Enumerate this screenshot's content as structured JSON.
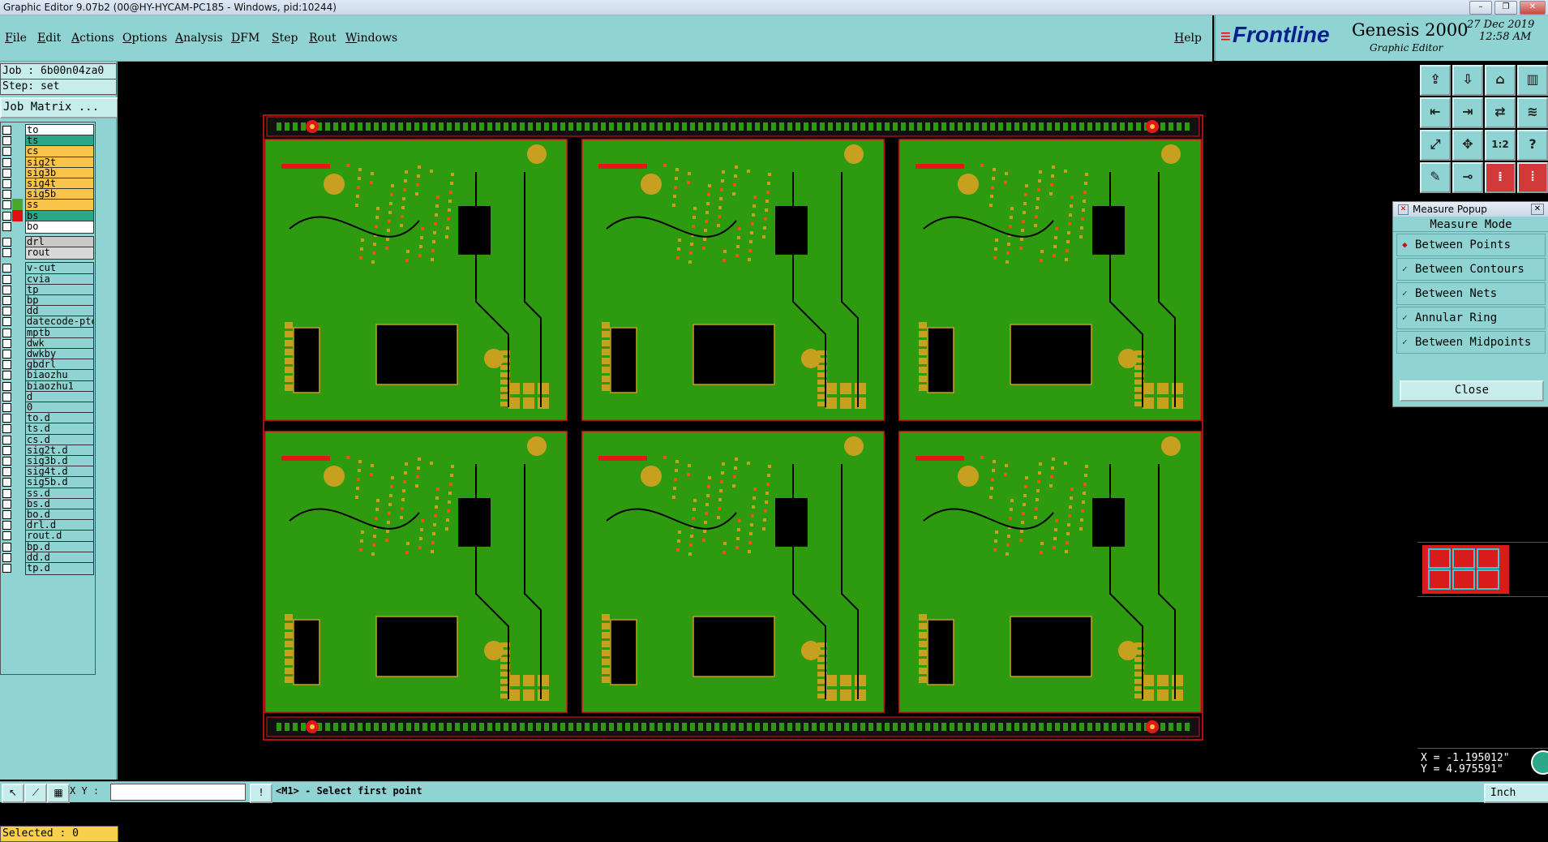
{
  "window": {
    "title": "Graphic Editor 9.07b2 (00@HY-HYCAM-PC185 - Windows, pid:10244)"
  },
  "menu": {
    "items": [
      "File",
      "Edit",
      "Actions",
      "Options",
      "Analysis",
      "DFM",
      "Step",
      "Rout",
      "Windows"
    ],
    "help": "Help"
  },
  "brand": {
    "logo": "Frontline",
    "product": "Genesis 2000",
    "subtitle": "Graphic Editor",
    "date": "27 Dec 2019",
    "time": "12:58 AM"
  },
  "left": {
    "job": "Job : 6b00n04za0",
    "step": "Step: set",
    "job_matrix": "Job Matrix ...",
    "selected": "Selected : 0"
  },
  "layers": [
    {
      "name": "to",
      "color": "#ffffff",
      "mark": ""
    },
    {
      "name": "ts",
      "color": "#2aa889",
      "mark": ""
    },
    {
      "name": "cs",
      "color": "#f9c44a",
      "mark": ""
    },
    {
      "name": "sig2t",
      "color": "#f9c44a",
      "mark": ""
    },
    {
      "name": "sig3b",
      "color": "#f9c44a",
      "mark": ""
    },
    {
      "name": "sig4t",
      "color": "#f9c44a",
      "mark": ""
    },
    {
      "name": "sig5b",
      "color": "#f9c44a",
      "mark": ""
    },
    {
      "name": "ss",
      "color": "#f9c44a",
      "mark": "#49a82a"
    },
    {
      "name": "bs",
      "color": "#2aa889",
      "mark": "#e01010"
    },
    {
      "name": "bo",
      "color": "#ffffff",
      "mark": ""
    },
    {
      "name": "drl",
      "color": "#c9c9c9",
      "mark": ""
    },
    {
      "name": "rout",
      "color": "#d8d8d8",
      "mark": ""
    },
    {
      "name": "v-cut",
      "color": "#8fd3d3",
      "mark": ""
    },
    {
      "name": "cvia",
      "color": "#8fd3d3",
      "mark": ""
    },
    {
      "name": "tp",
      "color": "#8fd3d3",
      "mark": ""
    },
    {
      "name": "bp",
      "color": "#8fd3d3",
      "mark": ""
    },
    {
      "name": "dd",
      "color": "#8fd3d3",
      "mark": ""
    },
    {
      "name": "datecode-pte",
      "color": "#8fd3d3",
      "mark": ""
    },
    {
      "name": "mptb",
      "color": "#8fd3d3",
      "mark": ""
    },
    {
      "name": "dwk",
      "color": "#8fd3d3",
      "mark": ""
    },
    {
      "name": "dwkby",
      "color": "#8fd3d3",
      "mark": ""
    },
    {
      "name": "gbdrl",
      "color": "#8fd3d3",
      "mark": ""
    },
    {
      "name": "biaozhu",
      "color": "#8fd3d3",
      "mark": ""
    },
    {
      "name": "biaozhu1",
      "color": "#8fd3d3",
      "mark": ""
    },
    {
      "name": "d",
      "color": "#8fd3d3",
      "mark": ""
    },
    {
      "name": "0",
      "color": "#8fd3d3",
      "mark": ""
    },
    {
      "name": "to.d",
      "color": "#8fd3d3",
      "mark": ""
    },
    {
      "name": "ts.d",
      "color": "#8fd3d3",
      "mark": ""
    },
    {
      "name": "cs.d",
      "color": "#8fd3d3",
      "mark": ""
    },
    {
      "name": "sig2t.d",
      "color": "#8fd3d3",
      "mark": ""
    },
    {
      "name": "sig3b.d",
      "color": "#8fd3d3",
      "mark": ""
    },
    {
      "name": "sig4t.d",
      "color": "#8fd3d3",
      "mark": ""
    },
    {
      "name": "sig5b.d",
      "color": "#8fd3d3",
      "mark": ""
    },
    {
      "name": "ss.d",
      "color": "#8fd3d3",
      "mark": ""
    },
    {
      "name": "bs.d",
      "color": "#8fd3d3",
      "mark": ""
    },
    {
      "name": "bo.d",
      "color": "#8fd3d3",
      "mark": ""
    },
    {
      "name": "drl.d",
      "color": "#8fd3d3",
      "mark": ""
    },
    {
      "name": "rout.d",
      "color": "#8fd3d3",
      "mark": ""
    },
    {
      "name": "bp.d",
      "color": "#8fd3d3",
      "mark": ""
    },
    {
      "name": "dd.d",
      "color": "#8fd3d3",
      "mark": ""
    },
    {
      "name": "tp.d",
      "color": "#8fd3d3",
      "mark": ""
    }
  ],
  "measure_popup": {
    "title": "Measure Popup",
    "mode_title": "Measure Mode",
    "options": [
      {
        "label": "Between Points",
        "selected": true
      },
      {
        "label": "Between Contours",
        "selected": false
      },
      {
        "label": "Between Nets",
        "selected": false
      },
      {
        "label": "Annular Ring",
        "selected": false
      },
      {
        "label": "Between Midpoints",
        "selected": false
      }
    ],
    "close": "Close"
  },
  "coords": {
    "x": "X = -1.195012\"",
    "y": "Y = 4.975591\""
  },
  "status": {
    "xy_label": "X Y :",
    "prompt": "<M1> - Select first point",
    "unit": "Inch"
  },
  "canvas": {
    "board_color": "#2e9a10",
    "pad_color": "#c8a020",
    "outline_color": "#e01818",
    "background": "#000000",
    "rows": 2,
    "cols": 3
  },
  "icons": [
    "layer-up-icon",
    "layer-down-icon",
    "home-icon",
    "grid-icon",
    "pan-left-icon",
    "pan-right-icon",
    "mirror-icon",
    "snap-icon",
    "zoom-fit-icon",
    "zoom-home-icon",
    "ratio-icon",
    "help-icon",
    "feature-icon",
    "measure-icon",
    "net-icon",
    "layer-view-icon"
  ]
}
